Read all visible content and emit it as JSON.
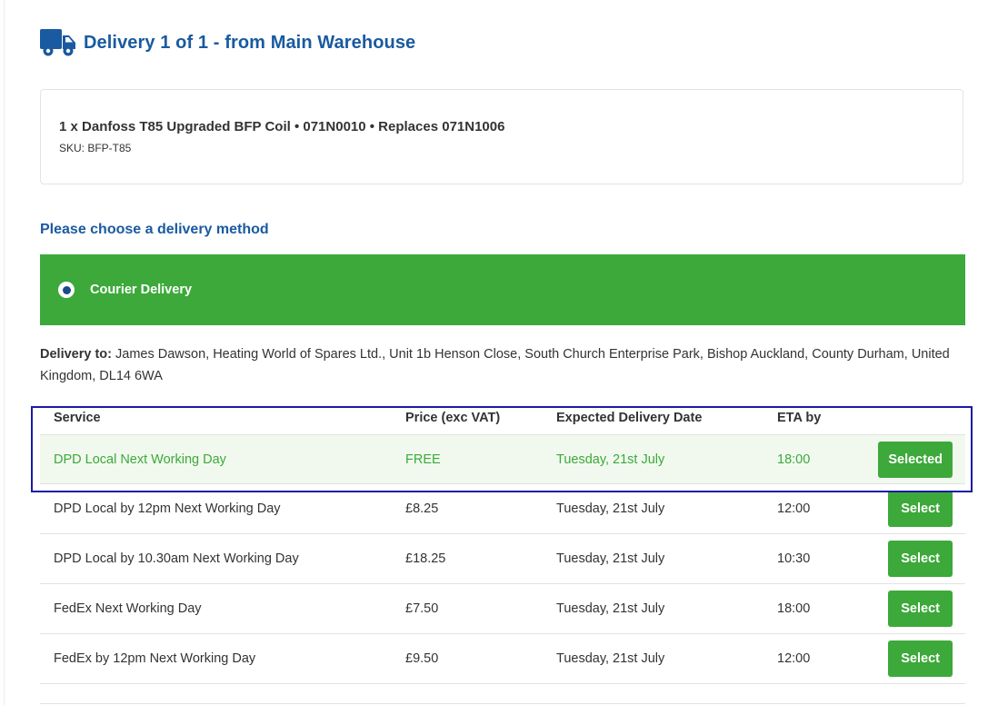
{
  "header": {
    "icon": "truck-icon",
    "title": "Delivery 1 of 1 - from Main Warehouse"
  },
  "item": {
    "name": "1 x Danfoss T85 Upgraded BFP Coil • 071N0010 • Replaces 071N1006",
    "sku": "SKU: BFP-T85"
  },
  "choose_label": "Please choose a delivery method",
  "method": {
    "label": "Courier Delivery",
    "selected": true
  },
  "delivery_to": {
    "label": "Delivery to:",
    "address": " James Dawson, Heating World of Spares Ltd., Unit 1b Henson Close, South Church Enterprise Park, Bishop Auckland, County Durham, United Kingdom, DL14 6WA"
  },
  "table": {
    "headers": {
      "service": "Service",
      "price": "Price (exc VAT)",
      "date": "Expected Delivery Date",
      "eta": "ETA by"
    },
    "rows": [
      {
        "service": "DPD Local Next Working Day",
        "price": "FREE",
        "date": "Tuesday, 21st July",
        "eta": "18:00",
        "button": "Selected"
      },
      {
        "service": "DPD Local by 12pm Next Working Day",
        "price": "£8.25",
        "date": "Tuesday, 21st July",
        "eta": "12:00",
        "button": "Select"
      },
      {
        "service": "DPD Local by 10.30am Next Working Day",
        "price": "£18.25",
        "date": "Tuesday, 21st July",
        "eta": "10:30",
        "button": "Select"
      },
      {
        "service": "FedEx Next Working Day",
        "price": "£7.50",
        "date": "Tuesday, 21st July",
        "eta": "18:00",
        "button": "Select"
      },
      {
        "service": "FedEx by 12pm Next Working Day",
        "price": "£9.50",
        "date": "Tuesday, 21st July",
        "eta": "12:00",
        "button": "Select"
      }
    ]
  },
  "colors": {
    "brand_blue": "#1a5aa0",
    "accent_green": "#3ca93a",
    "selected_row_bg": "#f1f9ef",
    "highlight_border": "#1a1aa6"
  }
}
